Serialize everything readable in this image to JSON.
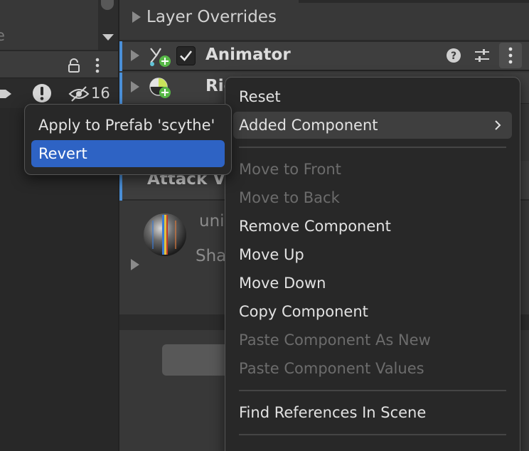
{
  "hierarchy": {
    "search_text": "e",
    "hidden_count": "16"
  },
  "inspector": {
    "layer_overrides_label": "Layer Overrides",
    "components": [
      {
        "label": "Animator",
        "enabled": true
      },
      {
        "label": "Rig"
      }
    ],
    "attack_label": "Attack Va",
    "material": {
      "name": "uni",
      "shader_label": "Sha"
    }
  },
  "context_menu": {
    "items": [
      {
        "label": "Reset",
        "enabled": true
      },
      {
        "label": "Added Component",
        "enabled": true,
        "has_submenu": true,
        "highlighted": true
      },
      {
        "label": "Move to Front",
        "enabled": false
      },
      {
        "label": "Move to Back",
        "enabled": false
      },
      {
        "label": "Remove Component",
        "enabled": true
      },
      {
        "label": "Move Up",
        "enabled": true
      },
      {
        "label": "Move Down",
        "enabled": true
      },
      {
        "label": "Copy Component",
        "enabled": true
      },
      {
        "label": "Paste Component As New",
        "enabled": false
      },
      {
        "label": "Paste Component Values",
        "enabled": false
      },
      {
        "label": "Find References In Scene",
        "enabled": true
      }
    ]
  },
  "revert_popup": {
    "apply_label": "Apply to Prefab 'scythe'",
    "revert_label": "Revert"
  },
  "colors": {
    "accent_blue": "#4a8fd8",
    "selection_blue": "#2e63c4",
    "panel_bg": "#383838",
    "menu_bg": "#282828"
  }
}
